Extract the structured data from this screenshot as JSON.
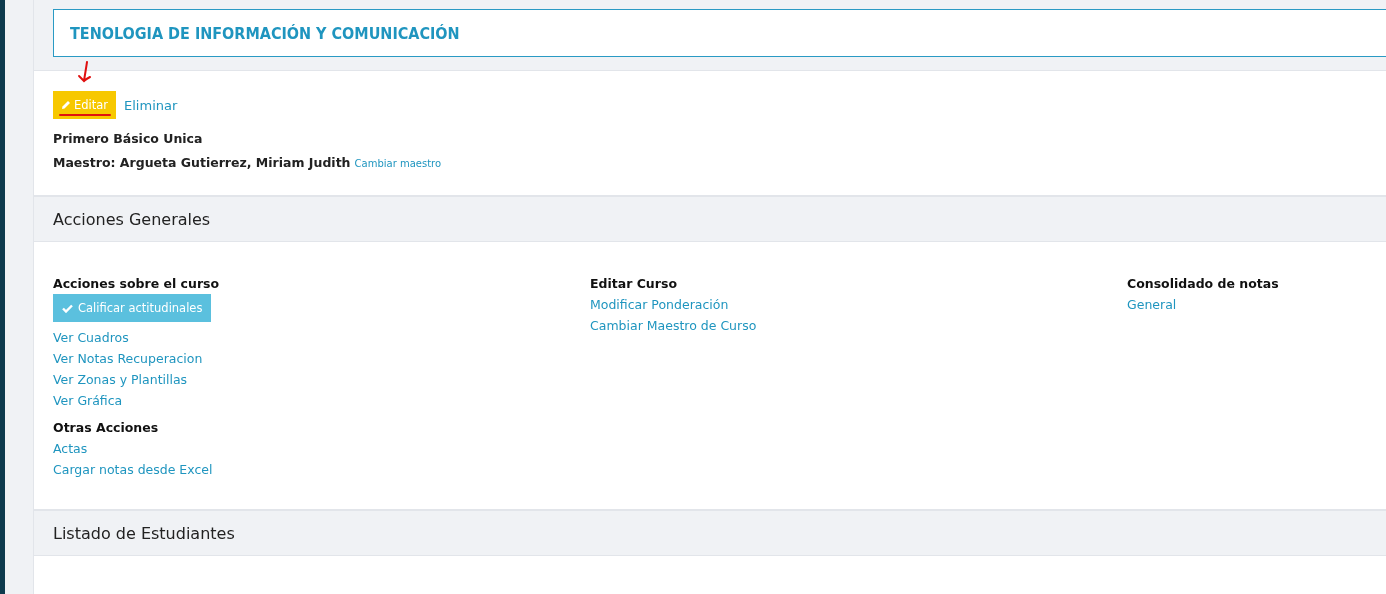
{
  "title": "TENOLOGIA DE INFORMACIÓN Y COMUNICACIÓN",
  "actions": [
    {
      "kind": "button",
      "label": "Editar"
    },
    {
      "kind": "link",
      "label": "Eliminar"
    }
  ],
  "course": "Primero Básico Unica",
  "teacher": {
    "text": "Maestro: Argueta Gutierrez, Miriam Judith",
    "link": "Cambiar maestro"
  },
  "sections": [
    {
      "title": "Acciones Generales",
      "columns": [
        {
          "groups": [
            {
              "heading": "Acciones sobre el curso",
              "items": [
                {
                  "kind": "button",
                  "label": "Calificar actitudinales"
                },
                {
                  "kind": "link",
                  "label": "Ver Cuadros"
                },
                {
                  "kind": "link",
                  "label": "Ver Notas Recuperacion"
                },
                {
                  "kind": "link",
                  "label": "Ver Zonas y Plantillas"
                },
                {
                  "kind": "link",
                  "label": "Ver Gráfica"
                }
              ]
            },
            {
              "heading": "Otras Acciones",
              "items": [
                {
                  "kind": "link",
                  "label": "Actas"
                },
                {
                  "kind": "link",
                  "label": "Cargar notas desde Excel"
                }
              ]
            }
          ]
        },
        {
          "groups": [
            {
              "heading": "Editar Curso",
              "items": [
                {
                  "kind": "link",
                  "label": "Modificar Ponderación"
                },
                {
                  "kind": "link",
                  "label": "Cambiar Maestro de Curso"
                }
              ]
            }
          ]
        },
        {
          "groups": [
            {
              "heading": "Consolidado de notas",
              "items": [
                {
                  "kind": "link",
                  "label": "General"
                }
              ]
            }
          ]
        }
      ]
    },
    {
      "title": "Listado de Estudiantes"
    }
  ]
}
